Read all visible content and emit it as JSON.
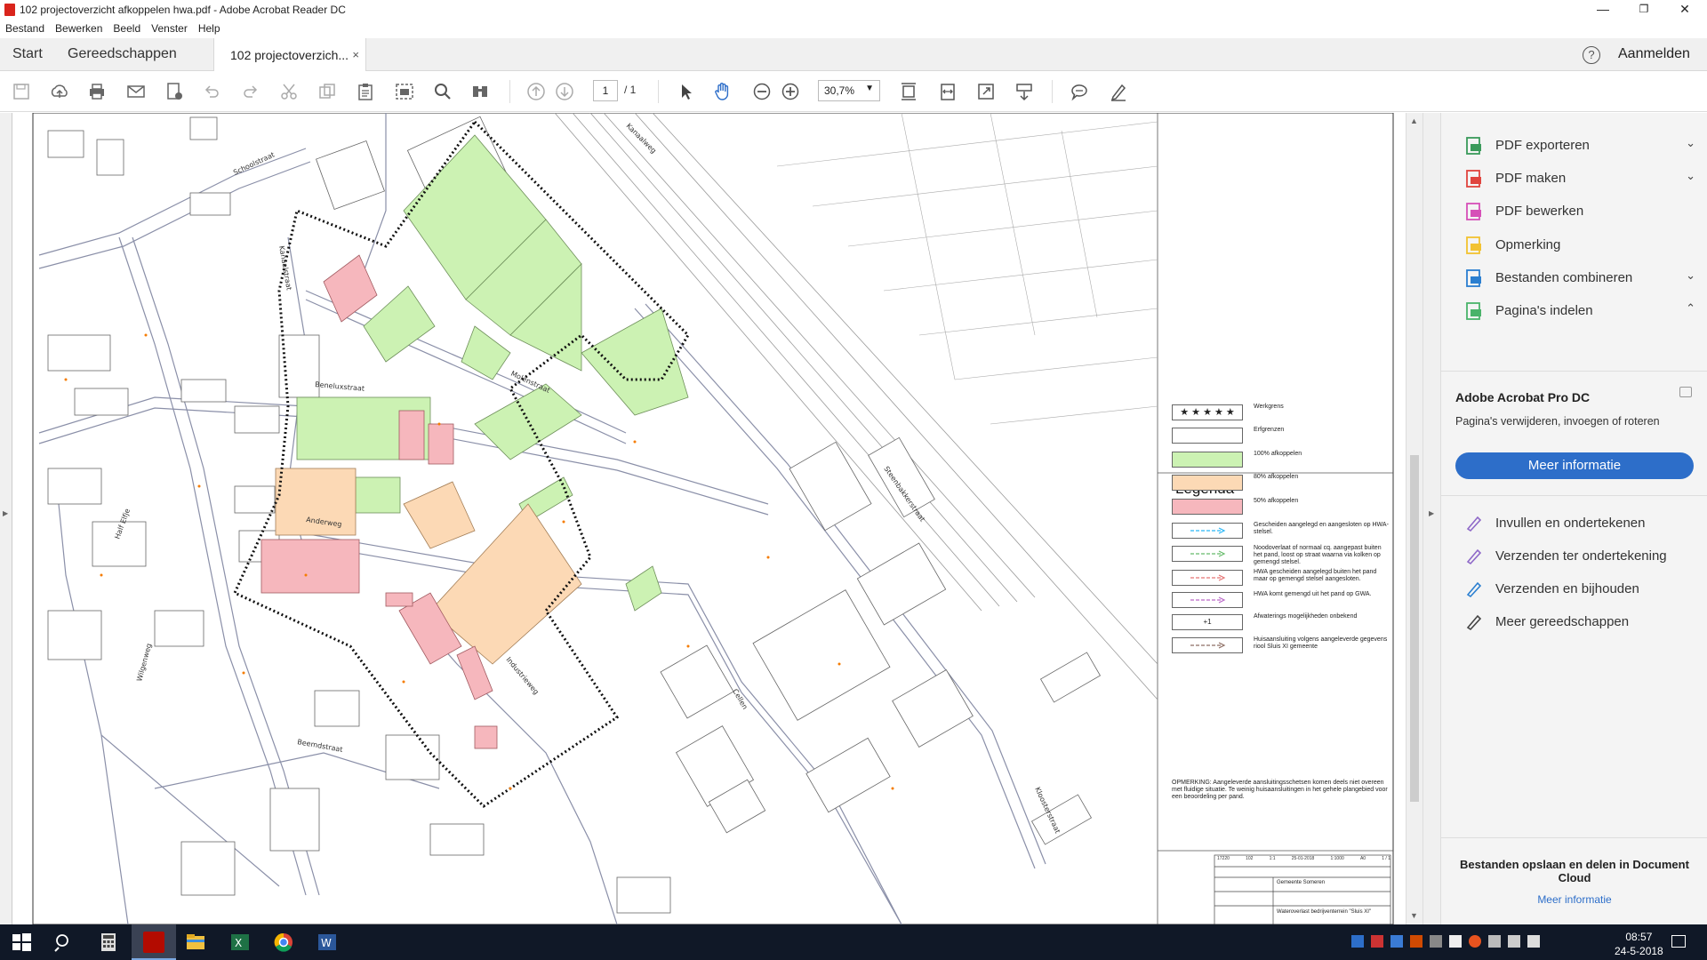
{
  "window": {
    "title": "102 projectoverzicht afkoppelen hwa.pdf - Adobe Acrobat Reader DC",
    "controls": [
      "—",
      "❐",
      "✕"
    ]
  },
  "menu": [
    "Bestand",
    "Bewerken",
    "Beeld",
    "Venster",
    "Help"
  ],
  "tabs": {
    "start": "Start",
    "tools": "Gereedschappen",
    "document": "102 projectoverzich...",
    "close": "×",
    "help": "?",
    "signin": "Aanmelden"
  },
  "toolbar": {
    "page_current": "1",
    "page_total": "/ 1",
    "zoom": "30,7%"
  },
  "map": {
    "streets": [
      "Schoolstraat",
      "Kanaalstraat",
      "Molenstraat",
      "Kanaalweg",
      "Beneluxstraat",
      "Steenbakkerstraat",
      "Anderweg",
      "Beemdstraat",
      "Kloosterstraat",
      "Half Elfje",
      "Wilgenweg",
      "Industrieweg",
      "Cellen"
    ],
    "legend": {
      "title": "Legenda",
      "items": [
        {
          "label": "Werkgrens",
          "swatch": "#ffffff",
          "style": "stars"
        },
        {
          "label": "Erfgrenzen",
          "swatch": "#ffffff",
          "style": "plain"
        },
        {
          "label": "100% afkoppelen",
          "swatch": "#ccf2b3",
          "style": "fill"
        },
        {
          "label": "80% afkoppelen",
          "swatch": "#fcd9b5",
          "style": "fill"
        },
        {
          "label": "50% afkoppelen",
          "swatch": "#f6b7bd",
          "style": "fill"
        },
        {
          "label": "Gescheiden aangelegd en aangesloten op HWA-stelsel.",
          "swatch": "#ffffff",
          "style": "arrow",
          "color": "#29b6f6"
        },
        {
          "label": "Noodoverlaat of normaal cq. aangepast buiten het pand, loost op straat waarna via kolken op gemengd stelsel.",
          "swatch": "#ffffff",
          "style": "arrow",
          "color": "#66bb6a"
        },
        {
          "label": "HWA gescheiden aangelegd buiten het pand maar op gemengd stelsel aangesloten.",
          "swatch": "#ffffff",
          "style": "arrow",
          "color": "#e57373"
        },
        {
          "label": "HWA komt gemengd uit het pand op GWA.",
          "swatch": "#ffffff",
          "style": "arrow",
          "color": "#ba68c8"
        },
        {
          "label": "Afwaterings mogelijkheden onbekend",
          "swatch": "#ffffff",
          "style": "text",
          "text": "+1"
        },
        {
          "label": "Huisaansluiting volgens aangeleverde gegevens riool Sluis XI gemeente",
          "swatch": "#ffffff",
          "style": "arrow",
          "color": "#8d6e63"
        }
      ],
      "note": "OPMERKING: Aangeleverde aansluitingsschetsen komen deels niet overeen met fluidige situatie. Te weinig huisaansluitingen in het gehele plangebied voor een beoordeling per pand."
    },
    "titleblock": {
      "row1": [
        "17220",
        "102",
        "1:1",
        "25-01-2018",
        "1:1000",
        "A0",
        "1 / 1"
      ],
      "client": "Gemeente Someren",
      "project": "Wateroverlast bedrijventerrein \"Sluis XI\""
    }
  },
  "right_panel": {
    "tools": [
      {
        "label": "PDF exporteren",
        "icon": "pdf-export-icon",
        "color": "#3a9a5a",
        "chevron": "⌄"
      },
      {
        "label": "PDF maken",
        "icon": "pdf-create-icon",
        "color": "#e0443e",
        "chevron": "⌄"
      },
      {
        "label": "PDF bewerken",
        "icon": "pdf-edit-icon",
        "color": "#d64fb8",
        "chevron": ""
      },
      {
        "label": "Opmerking",
        "icon": "comment-icon",
        "color": "#f2c230",
        "chevron": ""
      },
      {
        "label": "Bestanden combineren",
        "icon": "combine-files-icon",
        "color": "#2b7fd0",
        "chevron": "⌄"
      },
      {
        "label": "Pagina's indelen",
        "icon": "organize-pages-icon",
        "color": "#4ab36a",
        "chevron": "⌃"
      }
    ],
    "promo": {
      "title": "Adobe Acrobat Pro DC",
      "text": "Pagina's verwijderen, invoegen of roteren",
      "button": "Meer informatie"
    },
    "more_tools": [
      {
        "label": "Invullen en ondertekenen",
        "icon": "fill-sign-icon",
        "color": "#8e68c8"
      },
      {
        "label": "Verzenden ter ondertekening",
        "icon": "send-sign-icon",
        "color": "#8e68c8"
      },
      {
        "label": "Verzenden en bijhouden",
        "icon": "send-track-icon",
        "color": "#2b7fd0"
      },
      {
        "label": "Meer gereedschappen",
        "icon": "more-tools-icon",
        "color": "#444444"
      }
    ],
    "doc_cloud": {
      "title": "Bestanden opslaan en delen in Document Cloud",
      "link": "Meer informatie"
    }
  },
  "taskbar": {
    "time": "08:57",
    "date": "24-5-2018"
  }
}
